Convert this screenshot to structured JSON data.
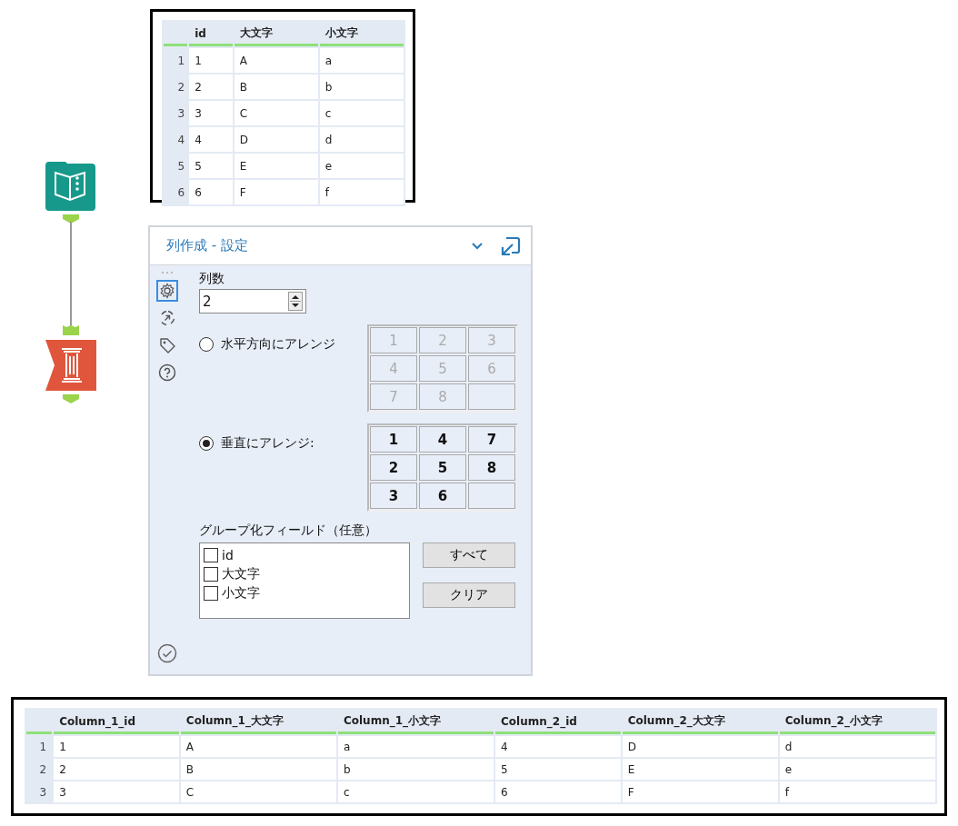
{
  "input_table": {
    "columns": [
      "id",
      "大文字",
      "小文字"
    ],
    "rows": [
      {
        "number": "1",
        "cells": [
          "1",
          "A",
          "a"
        ]
      },
      {
        "number": "2",
        "cells": [
          "2",
          "B",
          "b"
        ]
      },
      {
        "number": "3",
        "cells": [
          "3",
          "C",
          "c"
        ]
      },
      {
        "number": "4",
        "cells": [
          "4",
          "D",
          "d"
        ]
      },
      {
        "number": "5",
        "cells": [
          "5",
          "E",
          "e"
        ]
      },
      {
        "number": "6",
        "cells": [
          "6",
          "F",
          "f"
        ]
      }
    ]
  },
  "config": {
    "title": "列作成 - 設定",
    "side_tabs": [
      {
        "kind": "settings",
        "selected": true
      },
      {
        "kind": "connections",
        "selected": false
      },
      {
        "kind": "tag",
        "selected": false
      },
      {
        "kind": "help",
        "selected": false
      }
    ],
    "column_count": {
      "label": "列数",
      "value": "2"
    },
    "arrangements": [
      {
        "label": "水平方向にアレンジ",
        "selected": false,
        "grid": [
          [
            "1",
            "2",
            "3"
          ],
          [
            "4",
            "5",
            "6"
          ],
          [
            "7",
            "8"
          ]
        ]
      },
      {
        "label": "垂直にアレンジ:",
        "selected": true,
        "grid": [
          [
            "1",
            "4",
            "7"
          ],
          [
            "2",
            "5",
            "8"
          ],
          [
            "3",
            "6"
          ]
        ]
      }
    ],
    "group_fields": {
      "label": "グループ化フィールド（任意）",
      "items": [
        {
          "label": "id",
          "checked": false
        },
        {
          "label": "大文字",
          "checked": false
        },
        {
          "label": "小文字",
          "checked": false
        }
      ]
    },
    "buttons": [
      "すべて",
      "クリア"
    ]
  },
  "output_table": {
    "columns": [
      "Column_1_id",
      "Column_1_大文字",
      "Column_1_小文字",
      "Column_2_id",
      "Column_2_大文字",
      "Column_2_小文字"
    ],
    "rows": [
      {
        "number": "1",
        "cells": [
          "1",
          "A",
          "a",
          "4",
          "D",
          "d"
        ]
      },
      {
        "number": "2",
        "cells": [
          "2",
          "B",
          "b",
          "5",
          "E",
          "e"
        ]
      },
      {
        "number": "3",
        "cells": [
          "3",
          "C",
          "c",
          "6",
          "F",
          "f"
        ]
      }
    ]
  }
}
